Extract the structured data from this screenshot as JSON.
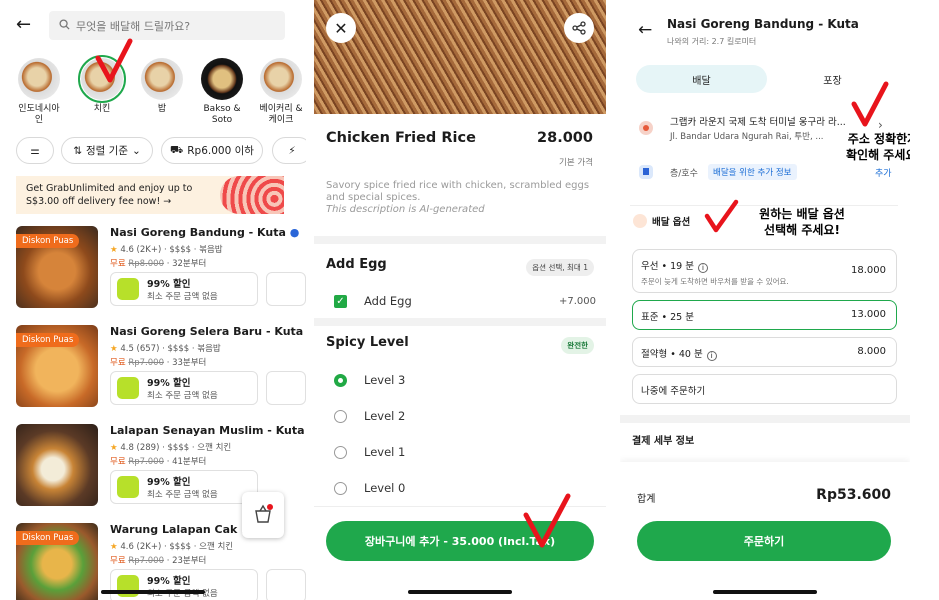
{
  "s1": {
    "search_placeholder": "무엇을 배달해 드릴까요?",
    "categories": [
      "인도네시아 인",
      "치킨",
      "밥",
      "Bakso & Soto",
      "베이커리 & 케이크"
    ],
    "chips": {
      "sort": "정렬 기준",
      "price": "Rp6.000 이하"
    },
    "promo": "Get GrabUnlimited and enjoy up to S$3.00 off delivery fee now! →",
    "restaurants": [
      {
        "tag": "Diskon Puas",
        "name": "Nasi Goreng Bandung - Kuta",
        "meta": "4.6 (2K+) · $$$$ · 볶음밥",
        "free": "무료",
        "old": "Rp8.000",
        "time": "· 32분부터",
        "c1": "99% 할인",
        "c2": "최소 주문 금액 없음"
      },
      {
        "tag": "Diskon Puas",
        "name": "Nasi Goreng Selera Baru - Kuta",
        "meta": "4.5 (657) · $$$$ · 볶음밥",
        "free": "무료",
        "old": "Rp7.000",
        "time": "· 33분부터",
        "c1": "99% 할인",
        "c2": "최소 주문 금액 없음"
      },
      {
        "tag": "",
        "name": "Lalapan Senayan Muslim - Kuta",
        "meta": "4.8 (289) · $$$$ · 으깬 치킨",
        "free": "무료",
        "old": "Rp7.000",
        "time": "· 41분부터",
        "c1": "99% 할인",
        "c2": "최소 주문 금액 없음"
      },
      {
        "tag": "Diskon Puas",
        "name": "Warung Lalapan Cak Man -",
        "meta": "4.6 (2K+) · $$$$ · 으깬 치킨",
        "free": "무료",
        "old": "Rp7.000",
        "time": "· 23분부터",
        "c1": "99% 할인",
        "c2": "최소 주문 금액 없음"
      }
    ]
  },
  "s2": {
    "title": "Chicken Fried Rice",
    "price": "28.000",
    "base_price": "기본 가격",
    "description": "Savory spice fried rice with chicken, scrambled eggs and special spices.",
    "ai_note": "This description is AI-generated",
    "add_egg_title": "Add Egg",
    "add_egg_badge": "옵션 선택, 최대 1",
    "egg_label": "Add Egg",
    "egg_price": "+7.000",
    "spicy_title": "Spicy Level",
    "spicy_badge": "완전한",
    "levels": [
      "Level 3",
      "Level 2",
      "Level 1",
      "Level 0"
    ],
    "cta": "장바구니에 추가 - 35.000 (Incl.Tax)"
  },
  "s3": {
    "title": "Nasi Goreng Bandung - Kuta",
    "distance": "나와의 거리: 2.7 킬로미터",
    "tabs": [
      "배달",
      "포장"
    ],
    "address_title": "그랩카 라운지 국제 도착 터미널 웅구라 라...",
    "address_sub": "Jl. Bandar Udara Ngurah Rai, 투반, ...",
    "floor": "층/호수",
    "extra_info": "배달을 위한 추가 정보",
    "add": "추가",
    "delivery_options": "배달 옵션",
    "opts": [
      {
        "label": "우선 • 19 분",
        "sub": "주문이 늦게 도착하면 바우처를 받을 수 있어요.",
        "price": "18.000"
      },
      {
        "label": "표준 • 25 분",
        "sub": "",
        "price": "13.000"
      },
      {
        "label": "절약형 • 40 분",
        "sub": "",
        "price": "8.000"
      }
    ],
    "later": "나중에 주문하기",
    "payment": "결제 세부 정보",
    "total_label": "합계",
    "total": "Rp53.600",
    "order": "주문하기",
    "annot1": "주소 정확한지\n확인해 주세요!",
    "annot2": "원하는 배달 옵션\n선택해 주세요!"
  },
  "colors": {
    "grab_green": "#1fa84c",
    "annotation_red": "#e8141c",
    "discount_orange": "#ef6c1c"
  }
}
